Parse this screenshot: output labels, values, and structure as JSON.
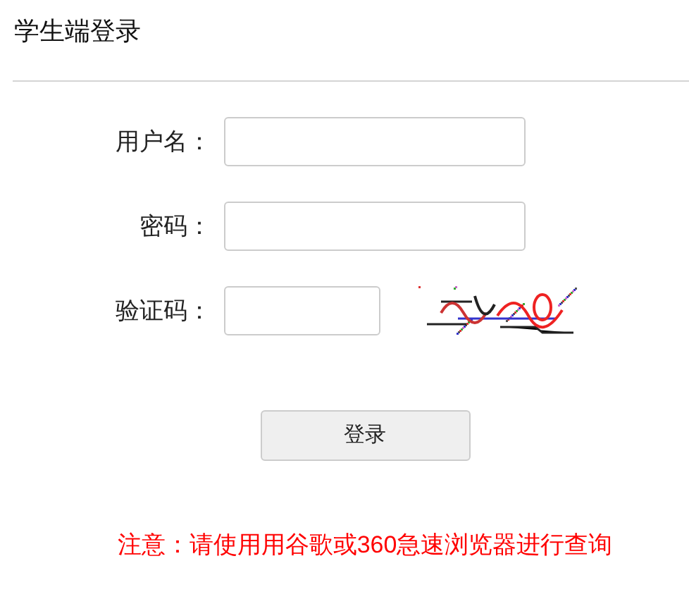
{
  "title": "学生端登录",
  "fields": [
    {
      "label": "用户名："
    },
    {
      "label": "密码："
    },
    {
      "label": "验证码：",
      "kind": "captcha"
    }
  ],
  "button": "登录",
  "notice": "注意：请使用用谷歌或360急速浏览器进行查询"
}
